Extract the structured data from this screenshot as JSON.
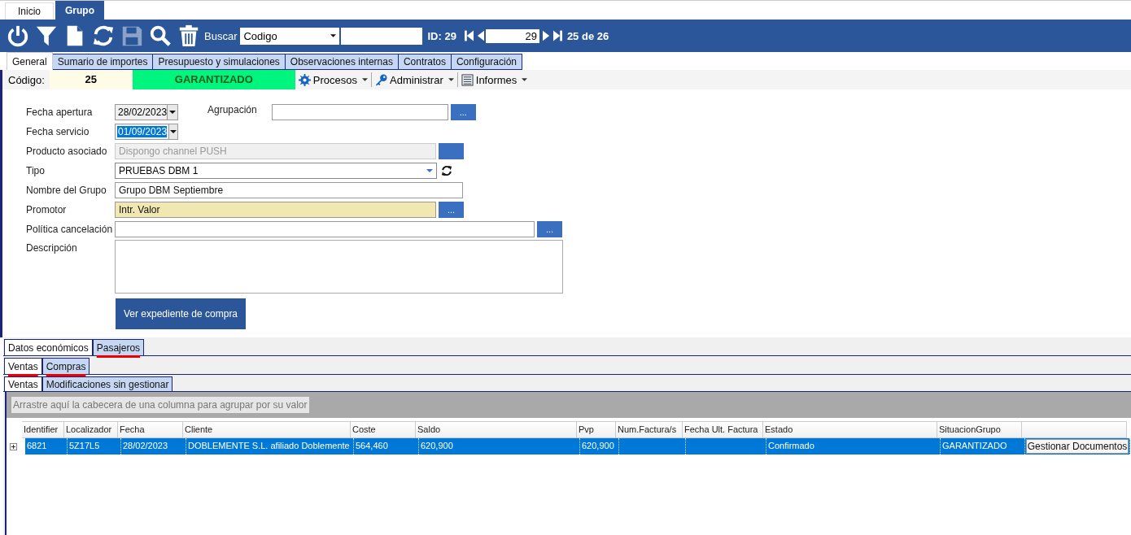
{
  "app_tabs": [
    {
      "label": "Inicio",
      "selected": false
    },
    {
      "label": "Grupo",
      "selected": true
    }
  ],
  "toolbar": {
    "tools": [
      {
        "kind": "power",
        "disabled": false
      },
      {
        "kind": "filter",
        "disabled": false
      },
      {
        "kind": "new",
        "disabled": false
      },
      {
        "kind": "refresh",
        "disabled": false
      },
      {
        "kind": "save",
        "disabled": true
      },
      {
        "kind": "search",
        "disabled": false
      },
      {
        "kind": "delete",
        "disabled": false
      }
    ],
    "search_label": "Buscar",
    "search_by": "Codigo",
    "id_label": "ID: 29",
    "record": "29",
    "record_count": "25 de 26"
  },
  "tabs": [
    {
      "label": "General",
      "selected": true
    },
    {
      "label": "Sumario de importes",
      "selected": false
    },
    {
      "label": "Presupuesto y simulaciones",
      "selected": false
    },
    {
      "label": "Observaciones internas",
      "selected": false
    },
    {
      "label": "Contratos",
      "selected": false
    },
    {
      "label": "Configuración",
      "selected": false
    }
  ],
  "info_bar": {
    "code_label": "Código:",
    "code": "25",
    "status": "GARANTIZADO",
    "menus": [
      {
        "kind": "gear",
        "label": "Procesos"
      },
      {
        "kind": "key",
        "label": "Administrar"
      },
      {
        "kind": "report",
        "label": "Informes"
      }
    ]
  },
  "form": {
    "rows": [
      {
        "label": "Fecha apertura",
        "kind": "date",
        "value": "28/02/2023",
        "selected": false,
        "side": {
          "label": "Agrupación",
          "kind": "lookup"
        }
      },
      {
        "label": "Fecha servicio",
        "kind": "date",
        "value": "01/09/2023",
        "selected": true
      },
      {
        "label": "Producto asociado",
        "kind": "lookup",
        "value": "Dispongo channel PUSH",
        "disabled": true
      },
      {
        "label": "Tipo",
        "kind": "combo",
        "value": "PRUEBAS DBM 1"
      },
      {
        "label": "Nombre del Grupo",
        "kind": "text",
        "value": "Grupo DBM Septiembre"
      },
      {
        "label": "Promotor",
        "kind": "lookup",
        "value": "Intr. Valor",
        "highlighted": true
      },
      {
        "label": "Política cancelación",
        "kind": "wide_lookup",
        "value": ""
      },
      {
        "label": "Descripción",
        "kind": "textarea",
        "value": ""
      }
    ],
    "lookup_button": "...",
    "action": "Ver expediente de compra"
  },
  "sub_tabs": [
    {
      "label": "Datos económicos",
      "selected": true,
      "underlined": false
    },
    {
      "label": "Pasajeros",
      "selected": false,
      "underlined": true
    }
  ],
  "sub_sub_tabs": [
    {
      "label": "Ventas",
      "selected": true,
      "underlined": true
    },
    {
      "label": "Compras",
      "selected": false,
      "underlined": true
    }
  ],
  "grid_tabs": [
    {
      "label": "Ventas",
      "selected": true
    },
    {
      "label": "Modificaciones sin gestionar",
      "selected": false
    }
  ],
  "grid": {
    "group_hint": "Arrastre aquí la cabecera de una columna para agrupar por su valor",
    "columns": [
      "Identifier",
      "Localizador",
      "Fecha",
      "Cliente",
      "Coste",
      "Saldo",
      "Pvp",
      "Num.Factura/s",
      "Fecha Ult. Factura",
      "Estado",
      "SituacionGrupo"
    ],
    "rows": [
      {
        "selected": true,
        "cells": [
          "6821",
          "5Z17L5",
          "28/02/2023",
          "DOBLEMENTE S.L. afiliado Doblemente",
          "564,460",
          "620,900",
          "620,900",
          "",
          "",
          "Confirmado",
          "GARANTIZADO"
        ],
        "action": "Gestionar Documentos"
      }
    ]
  }
}
